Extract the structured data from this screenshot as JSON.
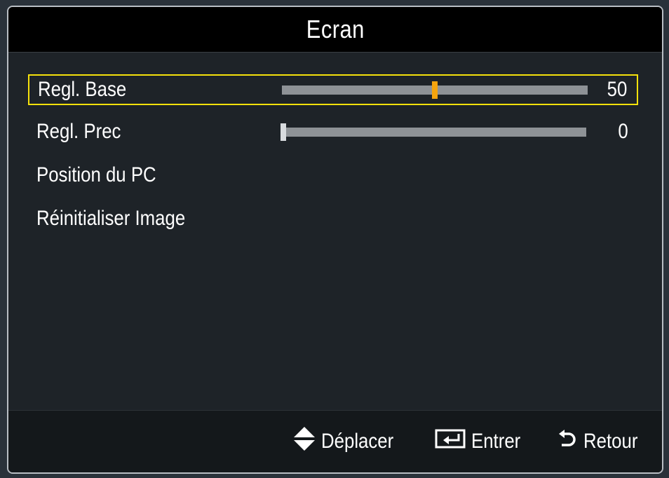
{
  "title": "Ecran",
  "colors": {
    "selection_border": "#f5e10b",
    "slider_track": "#8e9296",
    "thumb_active": "#f5a40e",
    "thumb_inactive": "#d8dbde"
  },
  "menu": [
    {
      "label": "Regl. Base",
      "has_slider": true,
      "value": "50",
      "level_fraction": 0.5,
      "selected": true
    },
    {
      "label": "Regl. Prec",
      "has_slider": true,
      "value": "0",
      "level_fraction": 0.0,
      "selected": false
    },
    {
      "label": "Position du PC",
      "has_slider": false,
      "selected": false
    },
    {
      "label": "Réinitialiser Image",
      "has_slider": false,
      "selected": false
    }
  ],
  "footer": {
    "move_icon": "up-down-arrows-icon",
    "move_label": "Déplacer",
    "enter_icon": "enter-icon",
    "enter_label": "Entrer",
    "return_icon": "return-icon",
    "return_label": "Retour"
  }
}
